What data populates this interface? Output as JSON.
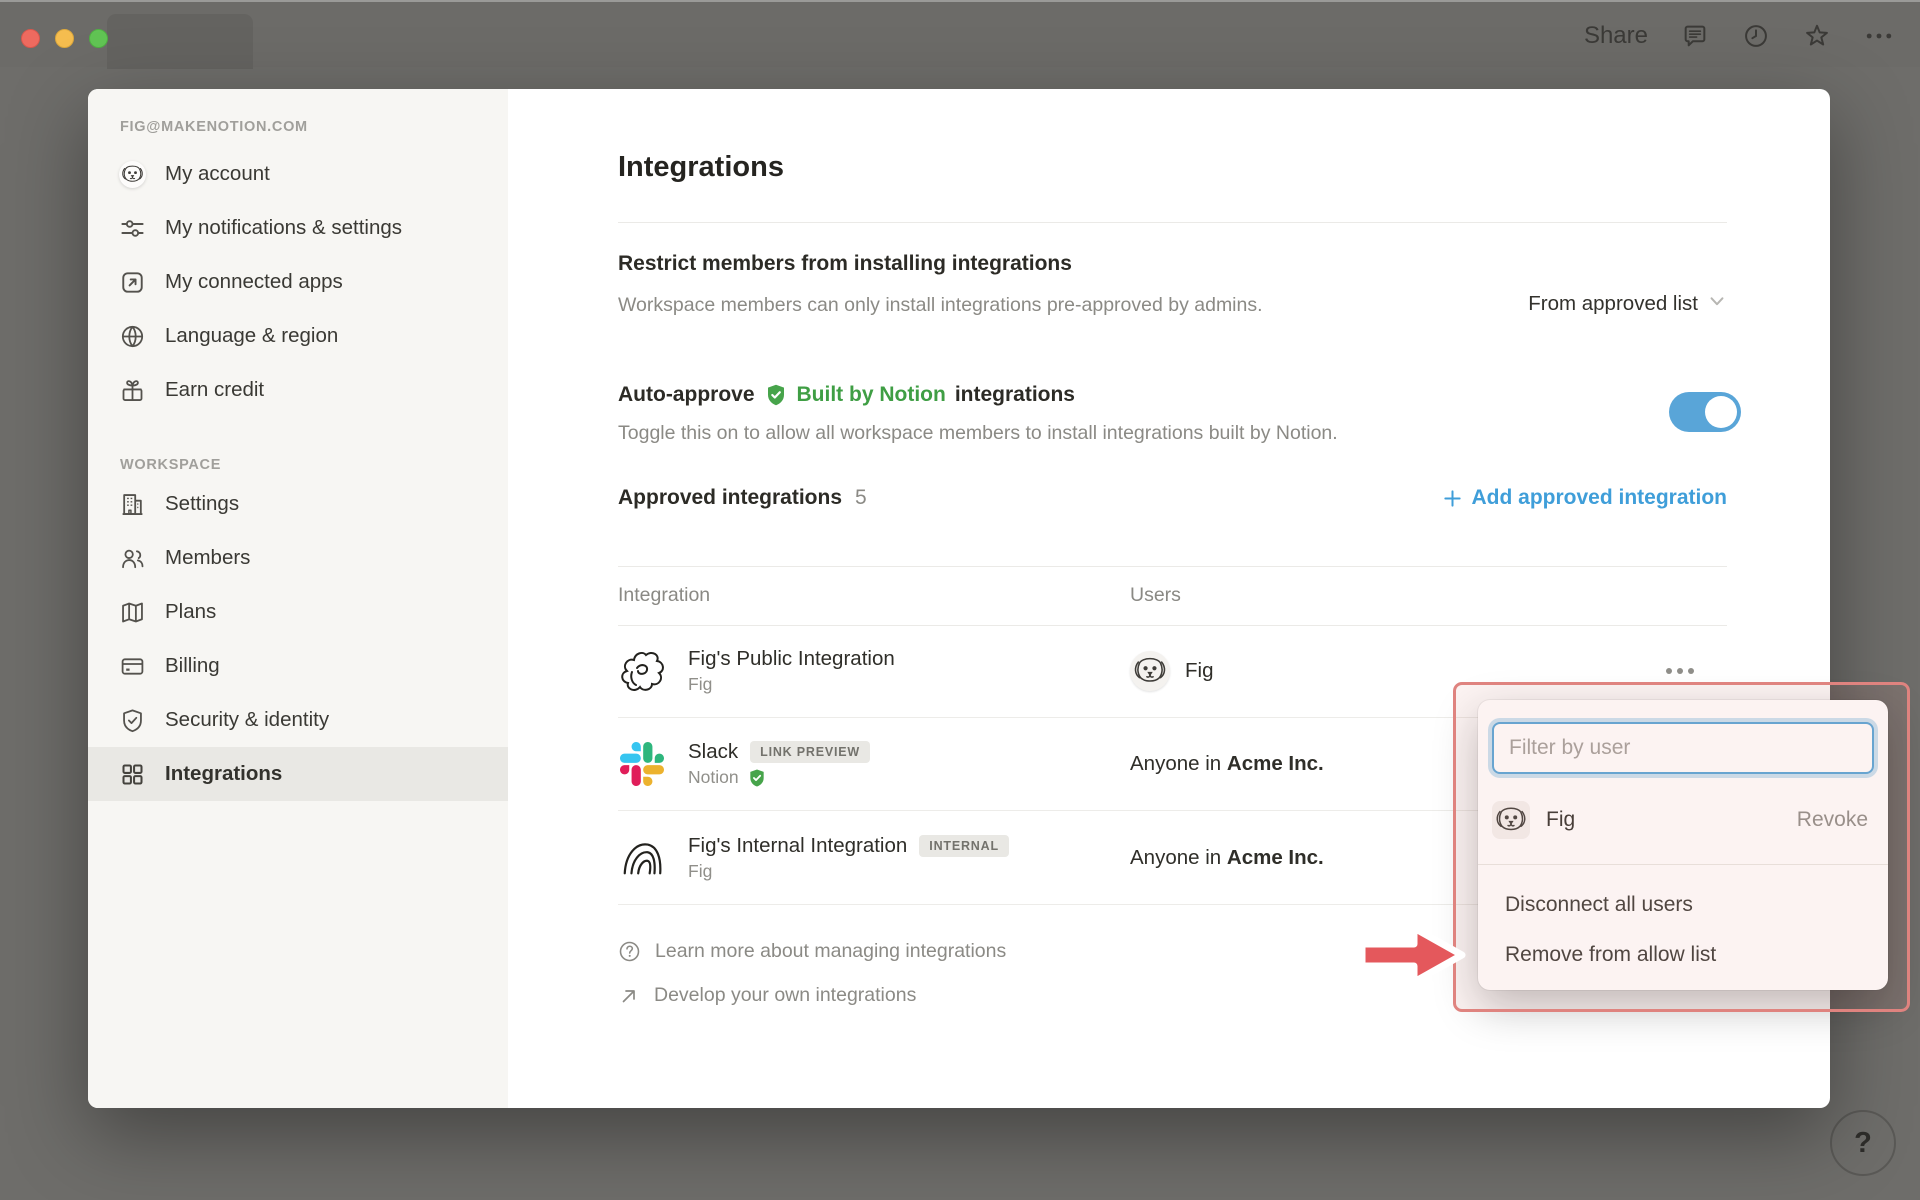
{
  "window": {
    "share_label": "Share"
  },
  "help_button": {
    "label": "?"
  },
  "sidebar": {
    "account_email": "FIG@MAKENOTION.COM",
    "account_items": [
      {
        "label": "My account"
      },
      {
        "label": "My notifications & settings"
      },
      {
        "label": "My connected apps"
      },
      {
        "label": "Language & region"
      },
      {
        "label": "Earn credit"
      }
    ],
    "workspace_heading": "WORKSPACE",
    "workspace_items": [
      {
        "label": "Settings"
      },
      {
        "label": "Members"
      },
      {
        "label": "Plans"
      },
      {
        "label": "Billing"
      },
      {
        "label": "Security & identity"
      },
      {
        "label": "Integrations"
      }
    ]
  },
  "main": {
    "title": "Integrations",
    "restrict": {
      "title": "Restrict members from installing integrations",
      "description": "Workspace members can only install integrations pre-approved by admins.",
      "dropdown_value": "From approved list"
    },
    "auto_approve": {
      "prefix": "Auto-approve",
      "badge": "Built by Notion",
      "suffix": "integrations",
      "description": "Toggle this on to allow all workspace members to install integrations built by Notion.",
      "toggle_state": "on"
    },
    "approved": {
      "title": "Approved integrations",
      "count": "5",
      "add_label": "Add approved integration"
    },
    "table": {
      "col_integration": "Integration",
      "col_users": "Users",
      "rows": [
        {
          "name": "Fig's Public Integration",
          "owner": "Fig",
          "user": "Fig"
        },
        {
          "name": "Slack",
          "badge": "LINK PREVIEW",
          "owner": "Notion",
          "users_prefix": "Anyone in",
          "users_org": "Acme Inc."
        },
        {
          "name": "Fig's Internal Integration",
          "badge": "INTERNAL",
          "owner": "Fig",
          "users_prefix": "Anyone in",
          "users_org": "Acme Inc."
        }
      ]
    },
    "footer": {
      "learn_more": "Learn more about managing integrations",
      "develop": "Develop your own integrations"
    }
  },
  "popup": {
    "filter_placeholder": "Filter by user",
    "user_name": "Fig",
    "revoke_label": "Revoke",
    "items": [
      "Disconnect all users",
      "Remove from allow list"
    ]
  },
  "colors": {
    "accent_blue": "#3F9ED9",
    "toggle_blue": "#59A5D8",
    "notion_green": "#3F9E44",
    "annotation_red": "#DF837F",
    "arrow_red": "#E4585C"
  }
}
